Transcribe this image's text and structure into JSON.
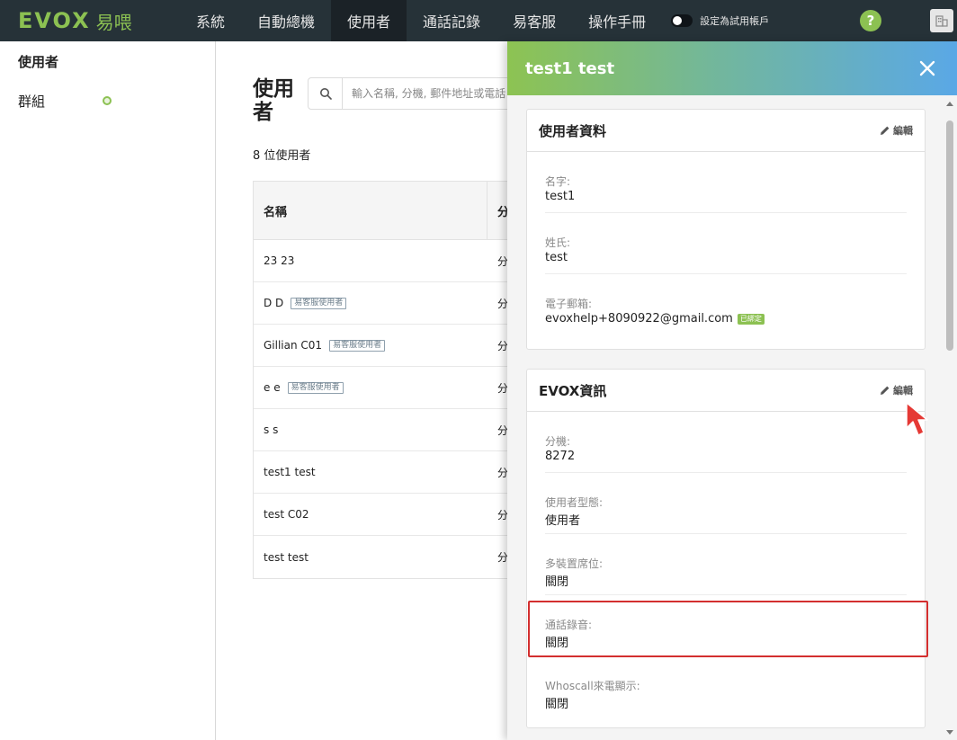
{
  "app": {
    "logo_text": "EVOX",
    "logo_sub": "易喂"
  },
  "nav": {
    "items": [
      {
        "label": "系統",
        "active": false
      },
      {
        "label": "自動總機",
        "active": false
      },
      {
        "label": "使用者",
        "active": true
      },
      {
        "label": "通話記錄",
        "active": false
      },
      {
        "label": "易客服",
        "active": false
      },
      {
        "label": "操作手冊",
        "active": false
      }
    ],
    "trial_toggle_label": "設定為試用帳戶",
    "help_label": "?",
    "accent_color": "#8cc152",
    "help_icon": "question-circle-icon",
    "org_icon": "building-icon"
  },
  "sidebar": {
    "items": [
      {
        "label": "使用者",
        "active": true
      },
      {
        "label": "群組",
        "active": false
      }
    ]
  },
  "main": {
    "title": "使用者",
    "search": {
      "placeholder": "輸入名稱, 分機, 郵件地址或電話"
    },
    "user_count": "8 位使用者",
    "table": {
      "columns": [
        "名稱",
        "分"
      ],
      "rows": [
        {
          "name": "23 23",
          "badge": "",
          "col2": "分"
        },
        {
          "name": "D D",
          "badge": "易客服使用者",
          "col2": "分"
        },
        {
          "name": "Gillian C01",
          "badge": "易客服使用者",
          "col2": "分"
        },
        {
          "name": "e e",
          "badge": "易客服使用者",
          "col2": "分"
        },
        {
          "name": "s s",
          "badge": "",
          "col2": "分"
        },
        {
          "name": "test1 test",
          "badge": "",
          "col2": "分"
        },
        {
          "name": "test C02",
          "badge": "",
          "col2": "分"
        },
        {
          "name": "test test",
          "badge": "",
          "col2": "分"
        }
      ]
    }
  },
  "panel": {
    "title": "test1 test",
    "header_gradient": [
      "#8dc352",
      "#5aa8e6"
    ],
    "user_info": {
      "title": "使用者資料",
      "edit_label": "編輯",
      "fields": [
        {
          "label": "名字:",
          "value": "test1"
        },
        {
          "label": "姓氏:",
          "value": "test"
        },
        {
          "label": "電子郵箱:",
          "value": "evoxhelp+8090922@gmail.com",
          "verified": "已綁定"
        }
      ]
    },
    "evox_info": {
      "title": "EVOX資訊",
      "edit_label": "編輯",
      "fields": [
        {
          "label": "分機:",
          "value": "8272"
        },
        {
          "label": "使用者型態:",
          "value": "使用者"
        },
        {
          "label": "多裝置席位:",
          "value": "關閉"
        },
        {
          "label": "通話錄音:",
          "value": "關閉"
        },
        {
          "label": "Whoscall來電顯示:",
          "value": "關閉"
        }
      ]
    },
    "highlight_color": "#d32f2f"
  }
}
